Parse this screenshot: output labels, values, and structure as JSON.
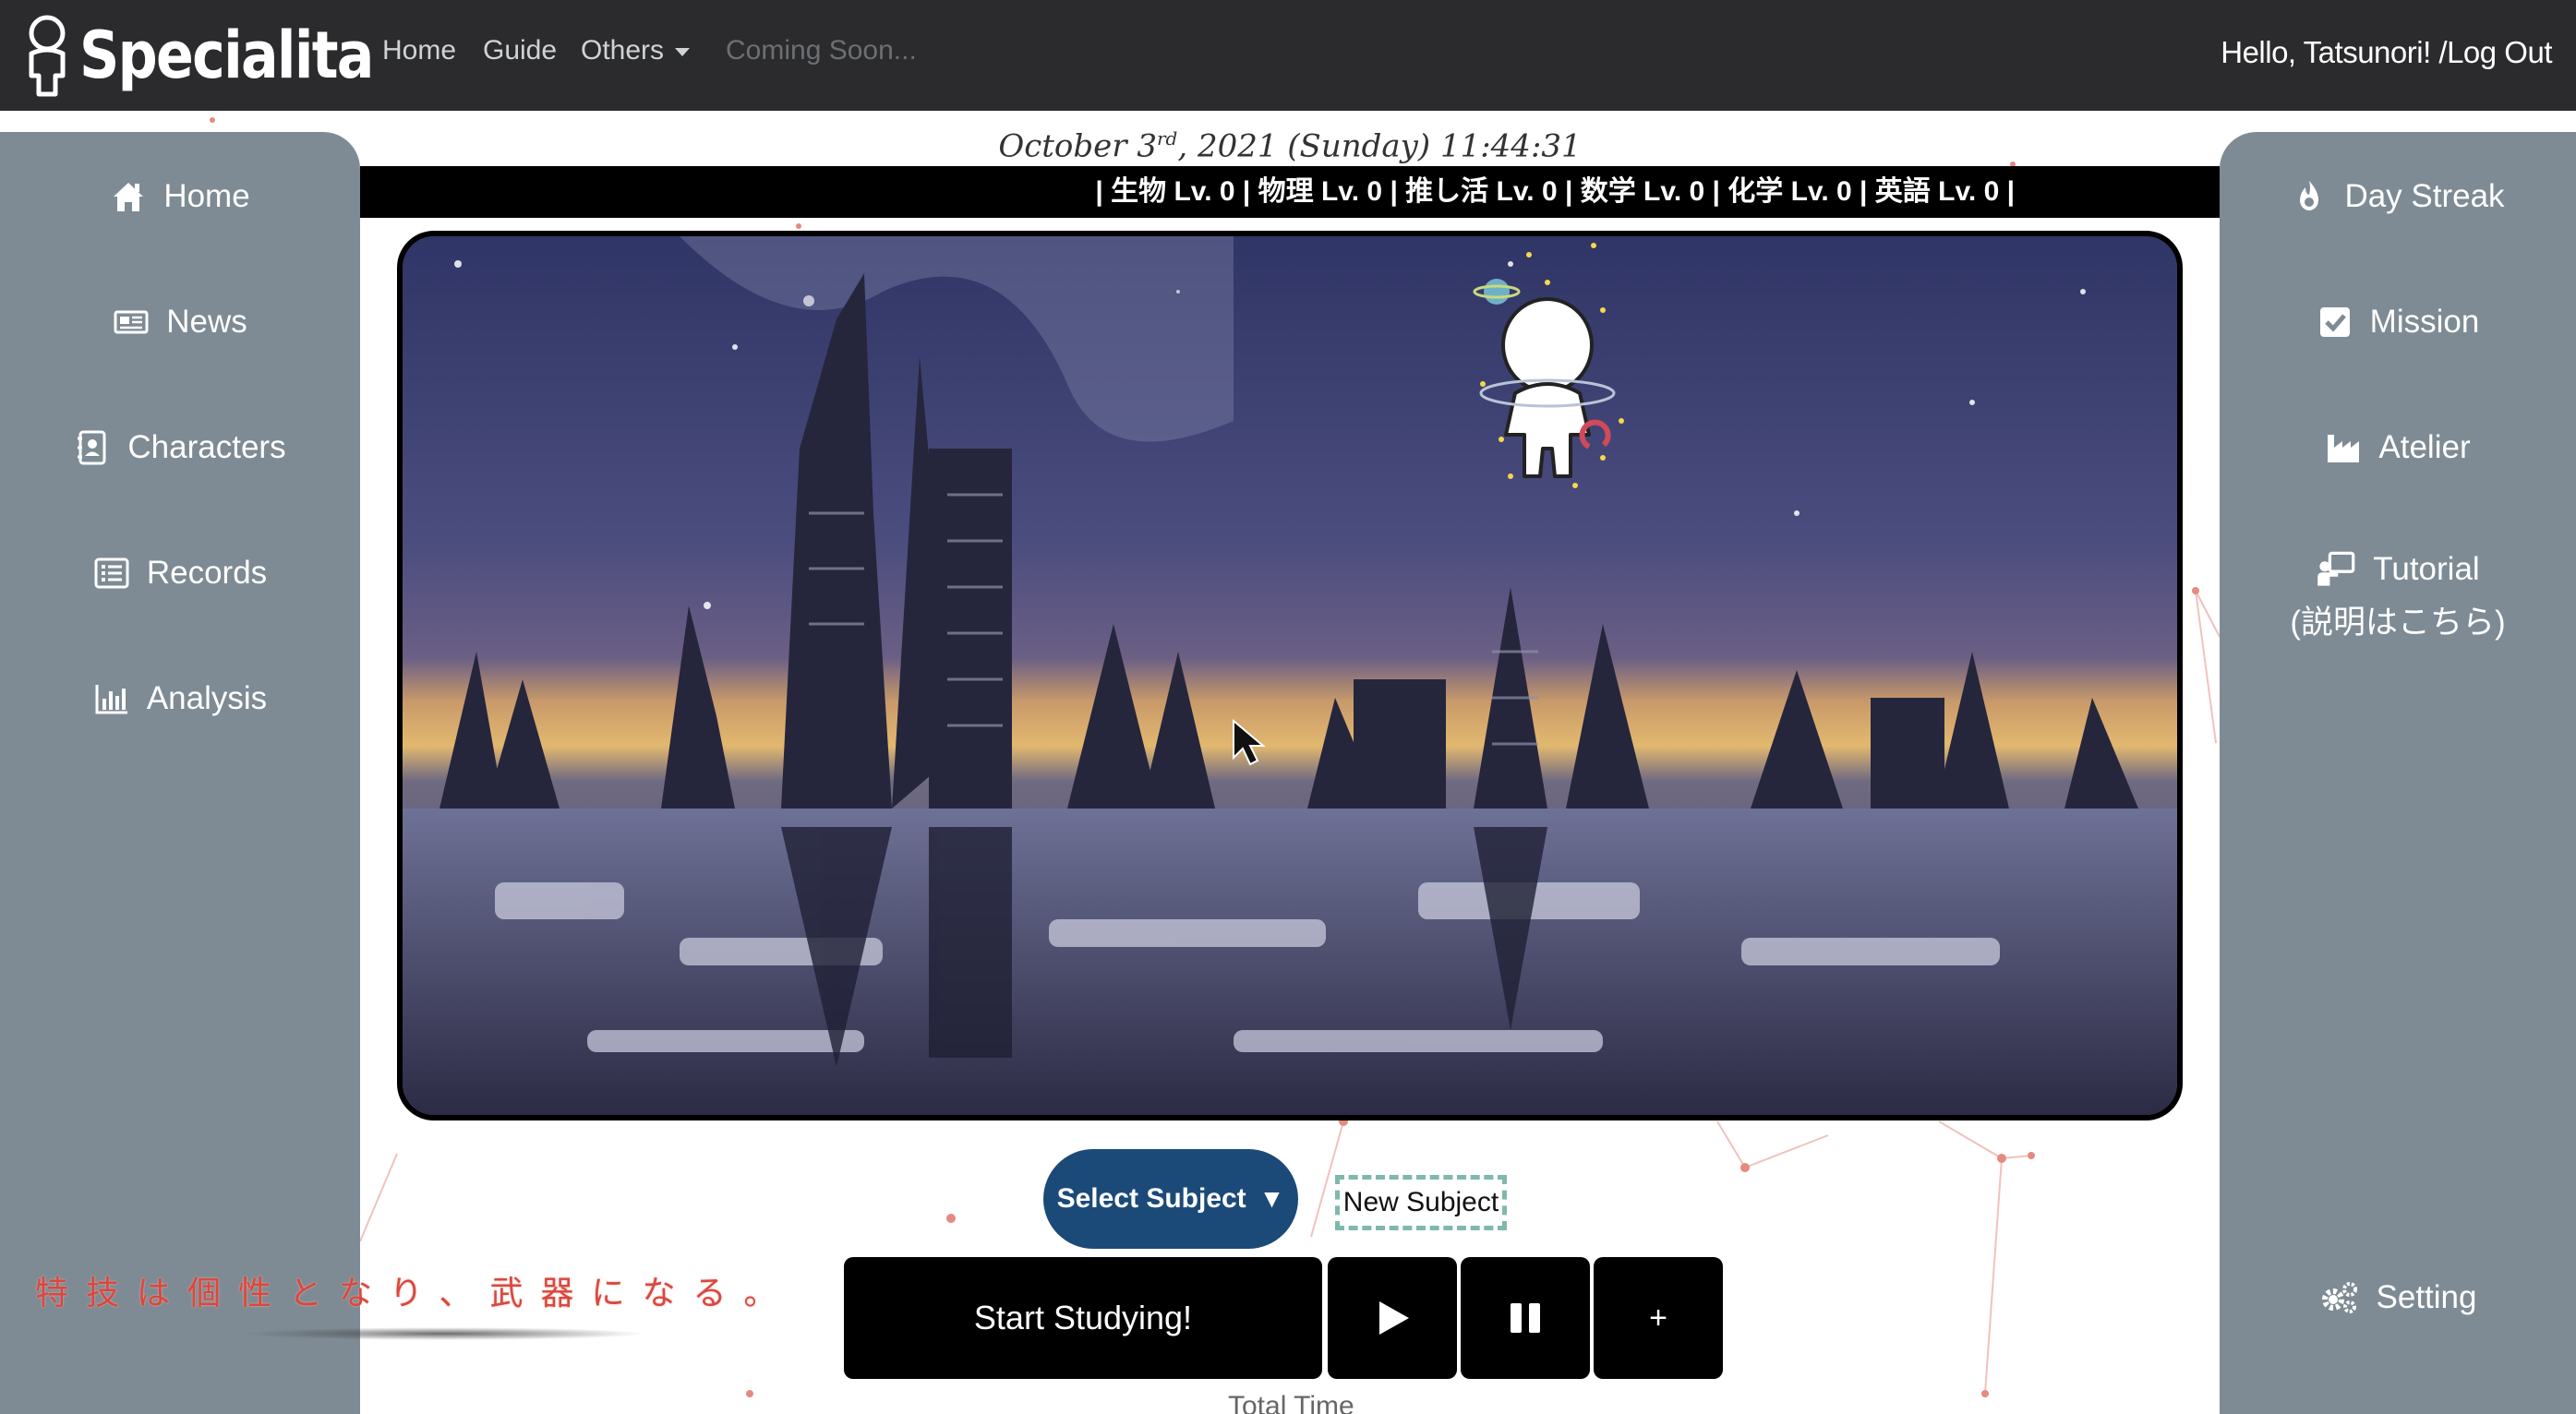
{
  "app": {
    "brand": "Specialita"
  },
  "nav": {
    "links": [
      "Home",
      "Guide",
      "Others",
      "Coming Soon..."
    ],
    "greeting": "Hello, Tatsunori! /Log Out"
  },
  "datetime": {
    "month_day": "October 3",
    "suffix": "rd",
    "rest": ", 2021 (Sunday) 11:44:31"
  },
  "levels": "| 生物 Lv. 0 | 物理 Lv. 0 | 推し活 Lv. 0 | 数学 Lv. 0 | 化学 Lv. 0 | 英語 Lv. 0 |",
  "left_menu": [
    {
      "label": "Home",
      "icon": "home-icon"
    },
    {
      "label": "News",
      "icon": "newspaper-icon"
    },
    {
      "label": "Characters",
      "icon": "contact-book-icon"
    },
    {
      "label": "Records",
      "icon": "list-icon"
    },
    {
      "label": "Analysis",
      "icon": "bar-chart-icon"
    }
  ],
  "right_menu": [
    {
      "label": "Day Streak",
      "icon": "fire-icon"
    },
    {
      "label": "Mission",
      "icon": "checkbox-icon"
    },
    {
      "label": "Atelier",
      "icon": "factory-icon"
    },
    {
      "label": "Tutorial",
      "sublabel": "(説明はこちら)",
      "icon": "chalkboard-teacher-icon"
    },
    {
      "label": "Setting",
      "icon": "gears-icon"
    }
  ],
  "subject": {
    "select_label": "Select Subject",
    "new_label": "New Subject"
  },
  "controls": {
    "start_label": "Start Studying!",
    "plus_label": "+"
  },
  "total_time_label": "Total Time",
  "slogan": "特技は個性となり、武器になる。",
  "colors": {
    "navbar": "#2b2b2d",
    "sidebar": "#7e8b94",
    "select_button": "#1c4a78",
    "slogan": "#d9483e"
  }
}
